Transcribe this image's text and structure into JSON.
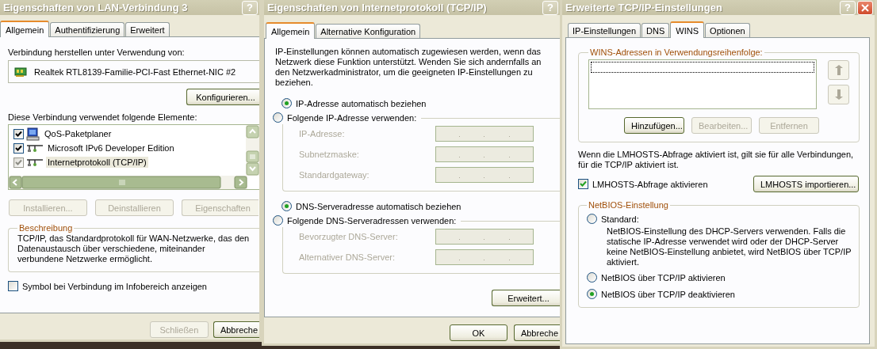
{
  "lan_properties": {
    "title": "Eigenschaften von LAN-Verbindung 3",
    "help_button": "?",
    "tabs": [
      {
        "label": "Allgemein",
        "selected": true
      },
      {
        "label": "Authentifizierung",
        "selected": false
      },
      {
        "label": "Erweitert",
        "selected": false
      }
    ],
    "connect_using_label": "Verbindung herstellen unter Verwendung von:",
    "adapter": "Realtek RTL8139-Familie-PCI-Fast Ethernet-NIC #2",
    "configure_button": {
      "label": "Konfigurieren...",
      "disabled": false
    },
    "components_label": "Diese Verbindung verwendet folgende Elemente:",
    "components": [
      {
        "label": "QoS-Paketplaner",
        "kind": "service",
        "checked": true,
        "selected": false
      },
      {
        "label": "Microsoft IPv6 Developer Edition",
        "kind": "protocol",
        "checked": true,
        "selected": false
      },
      {
        "label": "Internetprotokoll (TCP/IP)",
        "kind": "protocol",
        "checked": true,
        "selected": true
      }
    ],
    "component_buttons": [
      {
        "label": "Installieren...",
        "disabled": true
      },
      {
        "label": "Deinstallieren",
        "disabled": true
      },
      {
        "label": "Eigenschaften",
        "disabled": true
      }
    ],
    "description": {
      "title": "Beschreibung",
      "text": "TCP/IP, das Standardprotokoll für WAN-Netzwerke, das den Datenaustausch über verschiedene, miteinander verbundene Netzwerke ermöglicht."
    },
    "show_icon": {
      "label": "Symbol bei Verbindung im Infobereich anzeigen",
      "checked": false
    },
    "footer_buttons": [
      {
        "label": "Schließen",
        "disabled": true
      },
      {
        "label": "Abbreche",
        "disabled": false
      }
    ]
  },
  "tcpip_properties": {
    "title": "Eigenschaften von Internetprotokoll (TCP/IP)",
    "help_button": "?",
    "tabs": [
      {
        "label": "Allgemein",
        "selected": true
      },
      {
        "label": "Alternative Konfiguration",
        "selected": false
      }
    ],
    "intro": "IP-Einstellungen können automatisch zugewiesen werden, wenn das Netzwerk diese Funktion unterstützt. Wenden Sie sich andernfalls an den Netzwerkadministrator, um die geeigneten IP-Einstellungen zu beziehen.",
    "ip_options": [
      {
        "label": "IP-Adresse automatisch beziehen",
        "selected": true
      },
      {
        "label": "Folgende IP-Adresse verwenden:",
        "selected": false
      }
    ],
    "ip_fields": [
      {
        "label": "IP-Adresse:",
        "disabled": true
      },
      {
        "label": "Subnetzmaske:",
        "disabled": true
      },
      {
        "label": "Standardgateway:",
        "disabled": true
      }
    ],
    "dns_options": [
      {
        "label": "DNS-Serveradresse automatisch beziehen",
        "selected": true
      },
      {
        "label": "Folgende DNS-Serveradressen verwenden:",
        "selected": false
      }
    ],
    "dns_fields": [
      {
        "label": "Bevorzugter DNS-Server:",
        "disabled": true
      },
      {
        "label": "Alternativer DNS-Server:",
        "disabled": true
      }
    ],
    "advanced_button": {
      "label": "Erweitert...",
      "disabled": false
    },
    "footer_buttons": [
      {
        "label": "OK",
        "disabled": false
      },
      {
        "label": "Abbreche",
        "disabled": false
      }
    ]
  },
  "advanced_settings": {
    "title": "Erweiterte TCP/IP-Einstellungen",
    "help_button": "?",
    "tabs": [
      {
        "label": "IP-Einstellungen",
        "selected": false
      },
      {
        "label": "DNS",
        "selected": false
      },
      {
        "label": "WINS",
        "selected": true
      },
      {
        "label": "Optionen",
        "selected": false
      }
    ],
    "wins_group": {
      "title": "WINS-Adressen in Verwendungsreihenfolge:",
      "move_buttons": [
        {
          "kind": "up",
          "disabled": true
        },
        {
          "kind": "down",
          "disabled": true
        }
      ],
      "buttons": [
        {
          "label": "Hinzufügen...",
          "disabled": false
        },
        {
          "label": "Bearbeiten...",
          "disabled": true
        },
        {
          "label": "Entfernen",
          "disabled": true
        }
      ]
    },
    "lmhosts_info": "Wenn die LMHOSTS-Abfrage aktiviert ist, gilt sie für alle Verbindungen, für die TCP/IP aktiviert ist.",
    "lmhosts_checkbox": {
      "label": "LMHOSTS-Abfrage aktivieren",
      "checked": true
    },
    "import_button": {
      "label": "LMHOSTS importieren...",
      "disabled": false
    },
    "netbios": {
      "title": "NetBIOS-Einstellung",
      "options": [
        {
          "label": "Standard:",
          "selected": false,
          "description": "NetBIOS-Einstellung des DHCP-Servers verwenden. Falls die statische IP-Adresse verwendet wird oder der DHCP-Server keine NetBIOS-Einstellung anbietet, wird NetBIOS über TCP/IP aktiviert."
        },
        {
          "label": "NetBIOS über TCP/IP aktivieren",
          "selected": false
        },
        {
          "label": "NetBIOS über TCP/IP deaktivieren",
          "selected": true
        }
      ]
    }
  }
}
